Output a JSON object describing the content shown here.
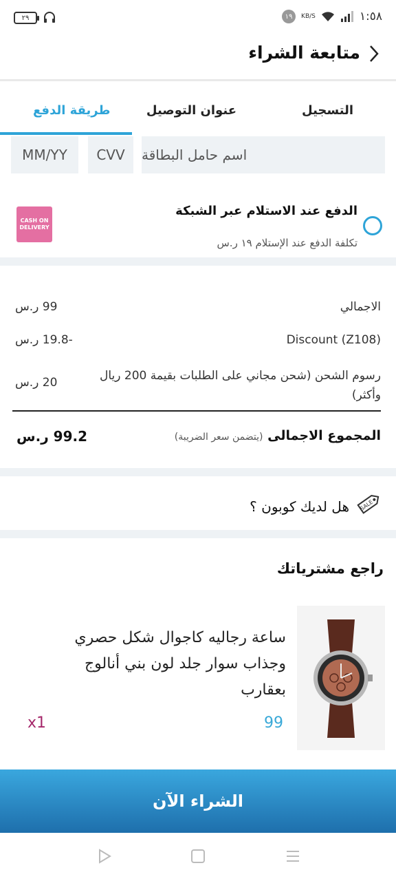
{
  "status_bar": {
    "battery": "٢٩",
    "notification_count": "١٩",
    "network_speed": "KB/S",
    "time": "١:٥٨"
  },
  "header": {
    "title": "متابعة الشراء"
  },
  "tabs": [
    {
      "label": "التسجيل",
      "active": false
    },
    {
      "label": "عنوان التوصيل",
      "active": false
    },
    {
      "label": "طريقة الدفع",
      "active": true
    }
  ],
  "card": {
    "holder_placeholder": "اسم حامل البطاقة",
    "cvv_placeholder": "CVV",
    "expiry_placeholder": "MM/YY"
  },
  "cod": {
    "title": "الدفع عند الاستلام عبر الشبكة",
    "subtitle": "تكلفة الدفع عند الإستلام ١٩ ر.س",
    "badge": "CASH ON DELIVERY"
  },
  "summary": {
    "rows": [
      {
        "label": "الاجمالي",
        "value": "99 ر.س"
      },
      {
        "label": "Discount (Z108)",
        "value": "-19.8 ر.س"
      },
      {
        "label": "رسوم الشحن (شحن مجاني على الطلبات بقيمة 200 ريال وأكثر)",
        "value": "20 ر.س"
      }
    ],
    "total_label": "المجموع الاجمالى",
    "total_note": "(يتضمن سعر الضريبة)",
    "total_value": "99.2 ر.س"
  },
  "coupon": {
    "text": "هل لديك كوبون ؟"
  },
  "review": {
    "title": "راجع مشترياتك",
    "product": {
      "name": "ساعة رجاليه كاجوال شكل حصري وجذاب سوار جلد لون بني أنالوج بعقارب",
      "price": "99",
      "quantity": "x1"
    }
  },
  "buy_button": "الشراء الآن",
  "colors": {
    "accent": "#2ea4d8",
    "price": "#3aa9d8",
    "quantity": "#a5276a",
    "badge": "#e46fa2",
    "field_bg": "#eef2f5"
  },
  "icons": {
    "back": "chevron-right-icon",
    "coupon": "sale-tag-icon",
    "nav_back": "play-icon",
    "nav_home": "square-icon",
    "nav_menu": "menu-icon"
  }
}
